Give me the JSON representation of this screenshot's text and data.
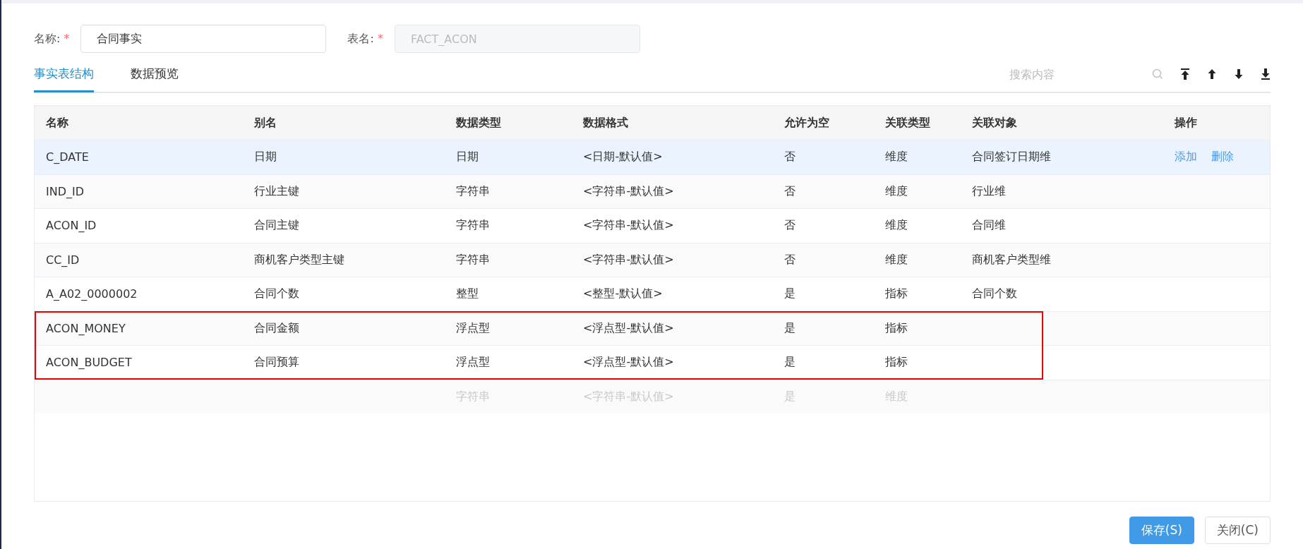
{
  "form": {
    "name_label": "名称:",
    "name_value": "合同事实",
    "table_label": "表名:",
    "table_value": "FACT_ACON",
    "required_mark": "*"
  },
  "tabs": [
    {
      "label": "事实表结构",
      "selected": true
    },
    {
      "label": "数据预览",
      "selected": false
    }
  ],
  "search": {
    "placeholder": "搜索内容"
  },
  "table": {
    "columns": [
      "名称",
      "别名",
      "数据类型",
      "数据格式",
      "允许为空",
      "关联类型",
      "关联对象",
      "操作"
    ],
    "rows": [
      {
        "kind": "field",
        "selected": true,
        "highlighted": false,
        "cells": [
          "C_DATE",
          "日期",
          "日期",
          "<日期-默认值>",
          "否",
          "维度",
          "合同签订日期维"
        ],
        "actions": [
          "添加",
          "删除"
        ]
      },
      {
        "kind": "field",
        "selected": false,
        "highlighted": false,
        "cells": [
          "IND_ID",
          "行业主键",
          "字符串",
          "<字符串-默认值>",
          "否",
          "维度",
          "行业维"
        ]
      },
      {
        "kind": "field",
        "selected": false,
        "highlighted": false,
        "cells": [
          "ACON_ID",
          "合同主键",
          "字符串",
          "<字符串-默认值>",
          "否",
          "维度",
          "合同维"
        ]
      },
      {
        "kind": "field",
        "selected": false,
        "highlighted": false,
        "cells": [
          "CC_ID",
          "商机客户类型主键",
          "字符串",
          "<字符串-默认值>",
          "否",
          "维度",
          "商机客户类型维"
        ]
      },
      {
        "kind": "field",
        "selected": false,
        "highlighted": false,
        "cells": [
          "A_A02_0000002",
          "合同个数",
          "整型",
          "<整型-默认值>",
          "是",
          "指标",
          "合同个数"
        ]
      },
      {
        "kind": "field",
        "selected": false,
        "highlighted": true,
        "cells": [
          "ACON_MONEY",
          "合同金额",
          "浮点型",
          "<浮点型-默认值>",
          "是",
          "指标",
          ""
        ]
      },
      {
        "kind": "field",
        "selected": false,
        "highlighted": true,
        "cells": [
          "ACON_BUDGET",
          "合同预算",
          "浮点型",
          "<浮点型-默认值>",
          "是",
          "指标",
          ""
        ]
      },
      {
        "kind": "new",
        "selected": false,
        "highlighted": false,
        "cells": [
          "",
          "",
          "字符串",
          "<字符串-默认值>",
          "是",
          "维度",
          ""
        ]
      }
    ]
  },
  "buttons": [
    {
      "label": "保存(S)",
      "kind": "primary"
    },
    {
      "label": "关闭(C)",
      "kind": "default"
    }
  ]
}
